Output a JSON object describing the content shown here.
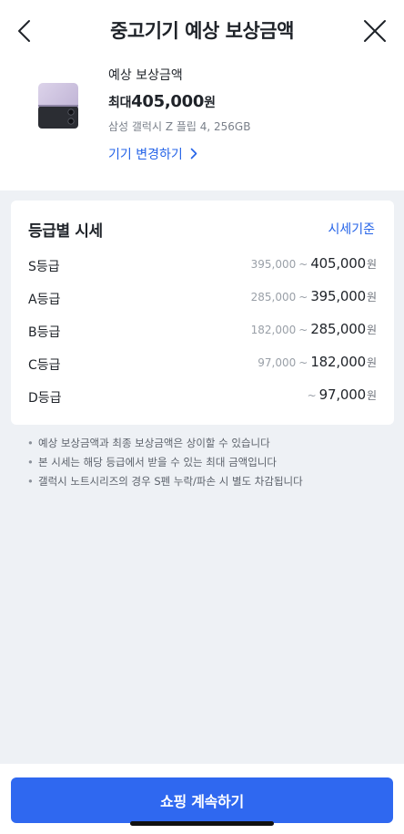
{
  "header": {
    "title": "중고기기 예상 보상금액"
  },
  "estimate": {
    "label": "예상 보상금액",
    "prefix": "최대",
    "amount": "405,000",
    "unit": "원",
    "device_name": "삼성 갤럭시 Z 플립 4, 256GB",
    "change_link": "기기 변경하기"
  },
  "grades": {
    "title": "등급별 시세",
    "criteria_link": "시세기준",
    "rows": [
      {
        "grade": "S등급",
        "min": "395,000",
        "max": "405,000"
      },
      {
        "grade": "A등급",
        "min": "285,000",
        "max": "395,000"
      },
      {
        "grade": "B등급",
        "min": "182,000",
        "max": "285,000"
      },
      {
        "grade": "C등급",
        "min": "97,000",
        "max": "182,000"
      },
      {
        "grade": "D등급",
        "min": "",
        "max": "97,000"
      }
    ],
    "tilde": "~",
    "unit": "원"
  },
  "notes": [
    "예상 보상금액과 최종 보상금액은 상이할 수 있습니다",
    "본 시세는 해당 등급에서 받을 수 있는 최대 금액입니다",
    "갤럭시 노트시리즈의 경우 S펜 누락/파손 시 별도 차감됩니다"
  ],
  "footer": {
    "cta_label": "쇼핑 계속하기"
  },
  "icons": {
    "back": "chevron-left-icon",
    "close": "close-icon",
    "link_arrow": "chevron-right-icon"
  },
  "colors": {
    "accent": "#2f68f0",
    "link": "#2463e8",
    "background": "#eef1f5"
  }
}
